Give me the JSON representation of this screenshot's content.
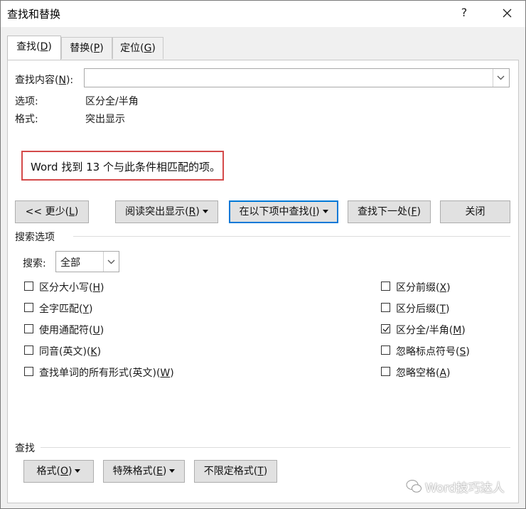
{
  "window": {
    "title": "查找和替换",
    "help_label": "?"
  },
  "tabs": [
    {
      "label": "查找",
      "key": "D"
    },
    {
      "label": "替换",
      "key": "P"
    },
    {
      "label": "定位",
      "key": "G"
    }
  ],
  "find": {
    "label": "查找内容",
    "key": "N",
    "label_suffix": "):",
    "value": "",
    "options_label": "选项:",
    "options_value": "区分全/半角",
    "format_label": "格式:",
    "format_value": "突出显示"
  },
  "message": "Word 找到 13 个与此条件相匹配的项。",
  "buttons": {
    "less": {
      "label": "<< 更少",
      "key": "L"
    },
    "reading_highlight": {
      "label": "阅读突出显示",
      "key": "R"
    },
    "find_in": {
      "label": "在以下项中查找",
      "key": "I"
    },
    "find_next": {
      "label": "查找下一处",
      "key": "F"
    },
    "close": {
      "label": "关闭"
    }
  },
  "search_options": {
    "section_label": "搜索选项",
    "search_label": "搜索",
    "search_suffix": ":",
    "search_value": "全部",
    "left": [
      {
        "label": "区分大小写",
        "key": "H",
        "checked": false
      },
      {
        "label": "全字匹配",
        "key": "Y",
        "checked": false
      },
      {
        "label": "使用通配符",
        "key": "U",
        "checked": false
      },
      {
        "label": "同音(英文)",
        "key": "K",
        "checked": false
      },
      {
        "label": "查找单词的所有形式(英文)",
        "key": "W",
        "checked": false
      }
    ],
    "right": [
      {
        "label": "区分前缀",
        "key": "X",
        "checked": false
      },
      {
        "label": "区分后缀",
        "key": "T",
        "checked": false
      },
      {
        "label": "区分全/半角",
        "key": "M",
        "checked": true
      },
      {
        "label": "忽略标点符号",
        "key": "S",
        "checked": false
      },
      {
        "label": "忽略空格",
        "key": "A",
        "checked": false
      }
    ]
  },
  "find_section": {
    "label": "查找",
    "format": {
      "label": "格式",
      "key": "O"
    },
    "special": {
      "label": "特殊格式",
      "key": "E"
    },
    "no_format": {
      "label": "不限定格式",
      "key": "T"
    }
  },
  "watermark": "Word技巧达人",
  "colors": {
    "message_border": "#d44a4a",
    "focus_border": "#0078d7",
    "dialog_bg": "#f0f0f0"
  }
}
